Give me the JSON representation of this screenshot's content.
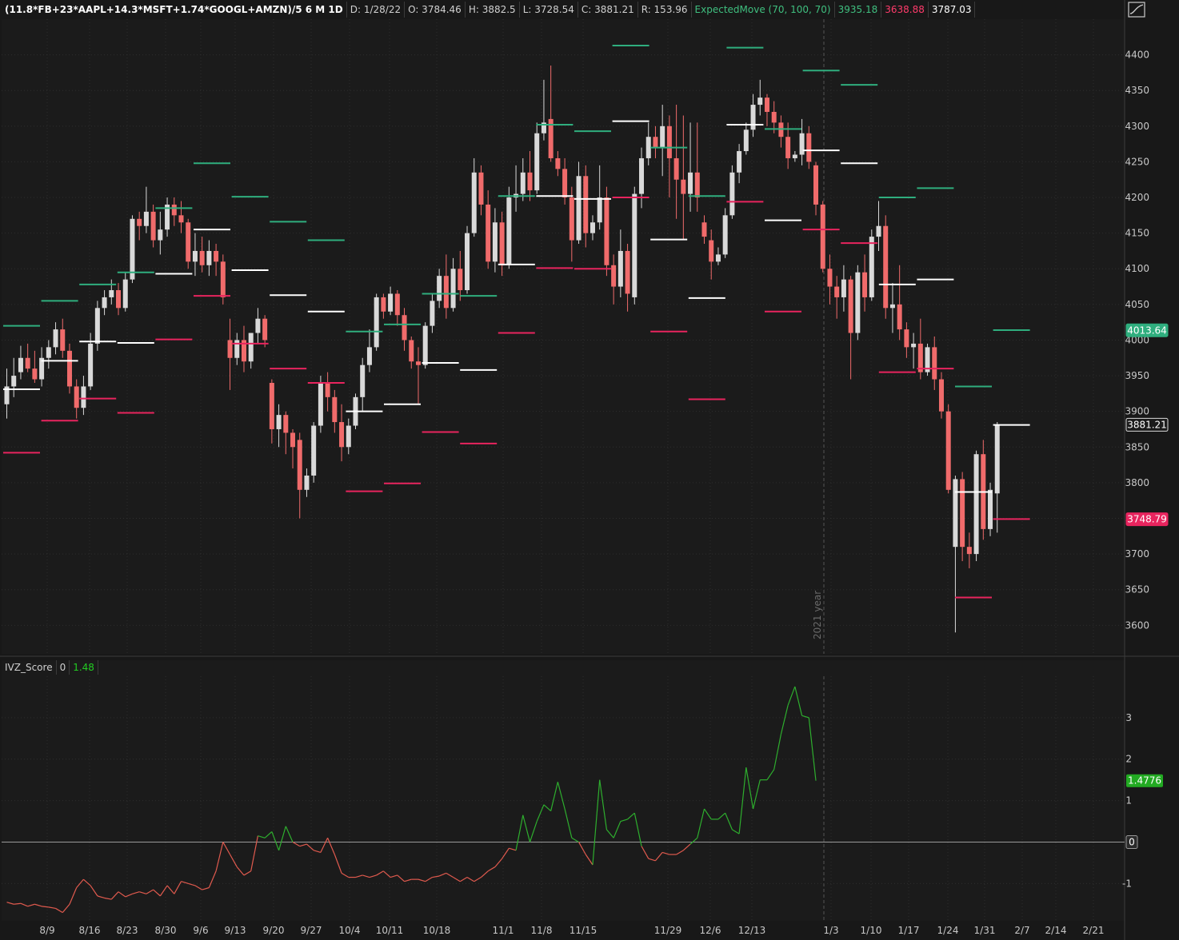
{
  "header": {
    "symbol": "(11.8*FB+23*AAPL+14.3*MSFT+1.74*GOOGL+AMZN)/5 6 M 1D",
    "date": "D: 1/28/22",
    "open": "O: 3784.46",
    "high": "H: 3882.5",
    "low": "L: 3728.54",
    "close": "C: 3881.21",
    "range": "R: 153.96",
    "study": "ExpectedMove (70, 100, 70)",
    "study_upper": "3935.18",
    "study_lower": "3638.88",
    "study_mid": "3787.03"
  },
  "indicator_header": {
    "name": "IVZ_Score",
    "param": "0",
    "value": "1.48"
  },
  "colors": {
    "background": "#181818",
    "up_candle": "#d9d9d9",
    "down_candle": "#f06b6b",
    "upper_band": "#2fae7e",
    "lower_band": "#e8245e",
    "weekly_mid": "#ffffff",
    "ind_positive": "#2eae2e",
    "ind_negative": "#e05a4e"
  },
  "chart_data": [
    {
      "type": "candlestick",
      "ylim": [
        3560,
        4450
      ],
      "y_ticks": [
        3600,
        3650,
        3700,
        3750,
        3800,
        3850,
        3900,
        3950,
        4000,
        4050,
        4100,
        4150,
        4200,
        4250,
        4300,
        4350,
        4400
      ],
      "x_tick_labels": [
        "8/9",
        "8/16",
        "8/23",
        "8/30",
        "9/6",
        "9/13",
        "9/20",
        "9/27",
        "10/4",
        "10/11",
        "10/18",
        "11/1",
        "11/8",
        "11/15",
        "11/29",
        "12/6",
        "12/13",
        "1/3",
        "1/10",
        "1/17",
        "1/24",
        "1/31",
        "2/7",
        "2/14",
        "2/21"
      ],
      "grid": true,
      "annotation": "2021 year",
      "price_labels": [
        {
          "value": "4013.64",
          "level": 4013.64,
          "color": "#2fae7e"
        },
        {
          "value": "3881.21",
          "level": 3881.21,
          "color": "#d9d9d9"
        },
        {
          "value": "3748.79",
          "level": 3748.79,
          "color": "#e8245e"
        }
      ],
      "candles": [
        [
          3910,
          3960,
          3890,
          3935
        ],
        [
          3935,
          3975,
          3920,
          3950
        ],
        [
          3955,
          3992,
          3945,
          3975
        ],
        [
          3975,
          3995,
          3955,
          3960
        ],
        [
          3960,
          3985,
          3940,
          3945
        ],
        [
          3945,
          3990,
          3935,
          3975
        ],
        [
          3975,
          4000,
          3960,
          3990
        ],
        [
          3990,
          4025,
          3980,
          4015
        ],
        [
          4015,
          4030,
          3975,
          3985
        ],
        [
          3985,
          3995,
          3925,
          3935
        ],
        [
          3935,
          3945,
          3890,
          3905
        ],
        [
          3905,
          3950,
          3895,
          3935
        ],
        [
          3935,
          4010,
          3930,
          3995
        ],
        [
          3995,
          4055,
          3985,
          4045
        ],
        [
          4045,
          4070,
          4035,
          4060
        ],
        [
          4060,
          4085,
          4050,
          4070
        ],
        [
          4070,
          4080,
          4035,
          4045
        ],
        [
          4045,
          4095,
          4040,
          4085
        ],
        [
          4085,
          4175,
          4080,
          4170
        ],
        [
          4170,
          4180,
          4140,
          4160
        ],
        [
          4160,
          4215,
          4150,
          4180
        ],
        [
          4180,
          4190,
          4130,
          4140
        ],
        [
          4140,
          4180,
          4120,
          4155
        ],
        [
          4155,
          4200,
          4145,
          4190
        ],
        [
          4190,
          4200,
          4160,
          4175
        ],
        [
          4175,
          4195,
          4150,
          4165
        ],
        [
          4165,
          4170,
          4100,
          4110
        ],
        [
          4110,
          4150,
          4090,
          4125
        ],
        [
          4125,
          4145,
          4095,
          4105
        ],
        [
          4105,
          4140,
          4090,
          4125
        ],
        [
          4125,
          4135,
          4090,
          4110
        ],
        [
          4110,
          4120,
          4050,
          4060
        ],
        [
          4000,
          4030,
          3930,
          3975
        ],
        [
          3975,
          4010,
          3965,
          4000
        ],
        [
          4000,
          4020,
          3955,
          3970
        ],
        [
          3970,
          4010,
          3960,
          4010
        ],
        [
          4010,
          4045,
          3995,
          4030
        ],
        [
          4030,
          4035,
          3990,
          4000
        ],
        [
          3940,
          3945,
          3855,
          3875
        ],
        [
          3875,
          3910,
          3850,
          3895
        ],
        [
          3895,
          3900,
          3840,
          3870
        ],
        [
          3870,
          3875,
          3820,
          3850
        ],
        [
          3860,
          3870,
          3750,
          3790
        ],
        [
          3790,
          3820,
          3780,
          3810
        ],
        [
          3810,
          3885,
          3800,
          3880
        ],
        [
          3880,
          3950,
          3870,
          3940
        ],
        [
          3940,
          3955,
          3900,
          3920
        ],
        [
          3920,
          3930,
          3870,
          3885
        ],
        [
          3885,
          3910,
          3830,
          3850
        ],
        [
          3850,
          3890,
          3840,
          3880
        ],
        [
          3880,
          3925,
          3875,
          3920
        ],
        [
          3920,
          3975,
          3900,
          3965
        ],
        [
          3965,
          4015,
          3955,
          3990
        ],
        [
          3990,
          4065,
          3985,
          4060
        ],
        [
          4060,
          4065,
          4030,
          4040
        ],
        [
          4040,
          4075,
          4035,
          4065
        ],
        [
          4065,
          4070,
          4020,
          4035
        ],
        [
          4035,
          4045,
          3985,
          4000
        ],
        [
          4000,
          4005,
          3960,
          3970
        ],
        [
          3970,
          3990,
          3910,
          3965
        ],
        [
          3965,
          4025,
          3960,
          4020
        ],
        [
          4020,
          4065,
          4010,
          4055
        ],
        [
          4055,
          4100,
          4045,
          4090
        ],
        [
          4090,
          4120,
          4030,
          4045
        ],
        [
          4045,
          4115,
          4040,
          4100
        ],
        [
          4100,
          4125,
          4055,
          4070
        ],
        [
          4070,
          4160,
          4065,
          4150
        ],
        [
          4150,
          4255,
          4145,
          4235
        ],
        [
          4235,
          4245,
          4175,
          4190
        ],
        [
          4190,
          4210,
          4100,
          4110
        ],
        [
          4110,
          4185,
          4095,
          4165
        ],
        [
          4165,
          4180,
          4090,
          4105
        ],
        [
          4105,
          4215,
          4100,
          4200
        ],
        [
          4200,
          4245,
          4180,
          4205
        ],
        [
          4205,
          4255,
          4195,
          4235
        ],
        [
          4235,
          4265,
          4195,
          4210
        ],
        [
          4210,
          4305,
          4205,
          4290
        ],
        [
          4290,
          4365,
          4280,
          4305
        ],
        [
          4310,
          4385,
          4250,
          4255
        ],
        [
          4255,
          4265,
          4230,
          4240
        ],
        [
          4240,
          4255,
          4190,
          4200
        ],
        [
          4200,
          4215,
          4110,
          4140
        ],
        [
          4140,
          4250,
          4135,
          4230
        ],
        [
          4230,
          4245,
          4130,
          4150
        ],
        [
          4150,
          4175,
          4140,
          4165
        ],
        [
          4165,
          4245,
          4155,
          4200
        ],
        [
          4200,
          4215,
          4090,
          4105
        ],
        [
          4105,
          4120,
          4050,
          4075
        ],
        [
          4075,
          4155,
          4060,
          4125
        ],
        [
          4125,
          4135,
          4040,
          4065
        ],
        [
          4060,
          4215,
          4050,
          4205
        ],
        [
          4205,
          4270,
          4185,
          4255
        ],
        [
          4255,
          4305,
          4245,
          4285
        ],
        [
          4285,
          4300,
          4255,
          4270
        ],
        [
          4270,
          4330,
          4230,
          4300
        ],
        [
          4300,
          4315,
          4200,
          4255
        ],
        [
          4255,
          4330,
          4170,
          4225
        ],
        [
          4225,
          4315,
          4140,
          4205
        ],
        [
          4205,
          4305,
          4180,
          4235
        ],
        [
          4235,
          4305,
          4180,
          4200
        ],
        [
          4165,
          4175,
          4135,
          4145
        ],
        [
          4140,
          4155,
          4085,
          4110
        ],
        [
          4110,
          4130,
          4105,
          4120
        ],
        [
          4120,
          4185,
          4115,
          4175
        ],
        [
          4175,
          4245,
          4170,
          4235
        ],
        [
          4235,
          4275,
          4220,
          4265
        ],
        [
          4265,
          4305,
          4260,
          4295
        ],
        [
          4295,
          4345,
          4285,
          4330
        ],
        [
          4330,
          4365,
          4315,
          4340
        ],
        [
          4340,
          4345,
          4300,
          4320
        ],
        [
          4320,
          4335,
          4290,
          4305
        ],
        [
          4305,
          4315,
          4270,
          4285
        ],
        [
          4285,
          4305,
          4240,
          4255
        ],
        [
          4255,
          4265,
          4250,
          4260
        ],
        [
          4260,
          4310,
          4245,
          4290
        ],
        [
          4290,
          4300,
          4240,
          4250
        ],
        [
          4245,
          4250,
          4175,
          4190
        ],
        [
          4190,
          4195,
          4095,
          4100
        ],
        [
          4100,
          4120,
          4050,
          4075
        ],
        [
          4075,
          4090,
          4030,
          4060
        ],
        [
          4060,
          4105,
          4040,
          4085
        ],
        [
          4085,
          4090,
          3945,
          4010
        ],
        [
          4010,
          4105,
          4000,
          4095
        ],
        [
          4095,
          4120,
          4040,
          4060
        ],
        [
          4060,
          4155,
          4055,
          4145
        ],
        [
          4145,
          4195,
          4125,
          4160
        ],
        [
          4160,
          4175,
          4030,
          4045
        ],
        [
          4045,
          4080,
          4010,
          4050
        ],
        [
          4050,
          4105,
          4000,
          4015
        ],
        [
          4015,
          4025,
          3975,
          3990
        ],
        [
          3990,
          4010,
          3960,
          3995
        ],
        [
          3995,
          4030,
          3945,
          3955
        ],
        [
          3955,
          3995,
          3950,
          3990
        ],
        [
          3990,
          4005,
          3930,
          3945
        ],
        [
          3945,
          3955,
          3890,
          3900
        ],
        [
          3900,
          3910,
          3785,
          3790
        ],
        [
          3710,
          3810,
          3590,
          3805
        ],
        [
          3805,
          3815,
          3690,
          3710
        ],
        [
          3710,
          3730,
          3680,
          3700
        ],
        [
          3700,
          3845,
          3690,
          3840
        ],
        [
          3840,
          3860,
          3720,
          3735
        ],
        [
          3735,
          3800,
          3725,
          3790
        ],
        [
          3785,
          3885,
          3730,
          3880
        ]
      ],
      "weekly_levels": [
        {
          "w": 0,
          "upper": 4020,
          "mid": 3931,
          "lower": 3842
        },
        {
          "w": 1,
          "upper": 4055,
          "mid": 3971,
          "lower": 3887
        },
        {
          "w": 2,
          "upper": 4078,
          "mid": 3998,
          "lower": 3918
        },
        {
          "w": 3,
          "upper": 4095,
          "mid": 3996,
          "lower": 3898
        },
        {
          "w": 4,
          "upper": 4185,
          "mid": 4093,
          "lower": 4001
        },
        {
          "w": 5,
          "upper": 4248,
          "mid": 4155,
          "lower": 4062
        },
        {
          "w": 6,
          "upper": 4201,
          "mid": 4098,
          "lower": 3995
        },
        {
          "w": 7,
          "upper": 4166,
          "mid": 4063,
          "lower": 3960
        },
        {
          "w": 8,
          "upper": 4140,
          "mid": 4040,
          "lower": 3940
        },
        {
          "w": 9,
          "upper": 4012,
          "mid": 3900,
          "lower": 3788
        },
        {
          "w": 10,
          "upper": 4022,
          "mid": 3910,
          "lower": 3799
        },
        {
          "w": 11,
          "upper": 4065,
          "mid": 3968,
          "lower": 3871
        },
        {
          "w": 12,
          "upper": 4062,
          "mid": 3958,
          "lower": 3855
        },
        {
          "w": 13,
          "upper": 4202,
          "mid": 4106,
          "lower": 4010
        },
        {
          "w": 14,
          "upper": 4302,
          "mid": 4202,
          "lower": 4101
        },
        {
          "w": 15,
          "upper": 4293,
          "mid": 4198,
          "lower": 4100
        },
        {
          "w": 16,
          "upper": 4413,
          "mid": 4307,
          "lower": 4200
        },
        {
          "w": 17,
          "upper": 4270,
          "mid": 4141,
          "lower": 4012
        },
        {
          "w": 18,
          "upper": 4202,
          "mid": 4059,
          "lower": 3917
        },
        {
          "w": 19,
          "upper": 4410,
          "mid": 4302,
          "lower": 4194
        },
        {
          "w": 20,
          "upper": 4296,
          "mid": 4168,
          "lower": 4040
        },
        {
          "w": 21,
          "upper": 4378,
          "mid": 4266,
          "lower": 4155
        },
        {
          "w": 22,
          "upper": 4358,
          "mid": 4248,
          "lower": 4136
        },
        {
          "w": 23,
          "upper": 4200,
          "mid": 4078,
          "lower": 3955
        },
        {
          "w": 24,
          "upper": 4213,
          "mid": 4085,
          "lower": 3960
        },
        {
          "w": 25,
          "upper": 3935,
          "mid": 3787,
          "lower": 3639
        },
        {
          "w": 26,
          "upper": 4014,
          "mid": 3881,
          "lower": 3749
        }
      ]
    },
    {
      "type": "line",
      "title": "IVZ_Score",
      "ylim": [
        -1.9,
        4.0
      ],
      "y_ticks": [
        -1,
        0,
        1,
        2,
        3
      ],
      "last_value": "1.4776",
      "zero_label": "0",
      "values": [
        -1.45,
        -1.5,
        -1.48,
        -1.55,
        -1.5,
        -1.55,
        -1.57,
        -1.6,
        -1.7,
        -1.5,
        -1.1,
        -0.9,
        -1.05,
        -1.3,
        -1.35,
        -1.38,
        -1.2,
        -1.32,
        -1.25,
        -1.2,
        -1.25,
        -1.15,
        -1.3,
        -1.05,
        -1.25,
        -0.95,
        -1.0,
        -1.05,
        -1.15,
        -1.1,
        -0.7,
        0.0,
        -0.3,
        -0.6,
        -0.8,
        -0.7,
        0.15,
        0.1,
        0.25,
        -0.2,
        0.38,
        0.0,
        -0.1,
        -0.05,
        -0.2,
        -0.25,
        0.1,
        -0.3,
        -0.75,
        -0.85,
        -0.85,
        -0.8,
        -0.85,
        -0.8,
        -0.7,
        -0.85,
        -0.8,
        -0.95,
        -0.9,
        -0.9,
        -0.95,
        -0.85,
        -0.82,
        -0.75,
        -0.85,
        -0.95,
        -0.85,
        -0.95,
        -0.85,
        -0.7,
        -0.6,
        -0.4,
        -0.15,
        -0.2,
        0.65,
        0.0,
        0.5,
        0.9,
        0.75,
        1.45,
        0.8,
        0.1,
        0.0,
        -0.3,
        -0.55,
        1.5,
        0.3,
        0.1,
        0.5,
        0.55,
        0.7,
        -0.1,
        -0.4,
        -0.45,
        -0.25,
        -0.3,
        -0.3,
        -0.2,
        -0.05,
        0.1,
        0.8,
        0.55,
        0.55,
        0.7,
        0.3,
        0.2,
        1.8,
        0.8,
        1.5,
        1.5,
        1.75,
        2.6,
        3.3,
        3.75,
        3.05,
        3.0,
        1.48
      ]
    }
  ]
}
